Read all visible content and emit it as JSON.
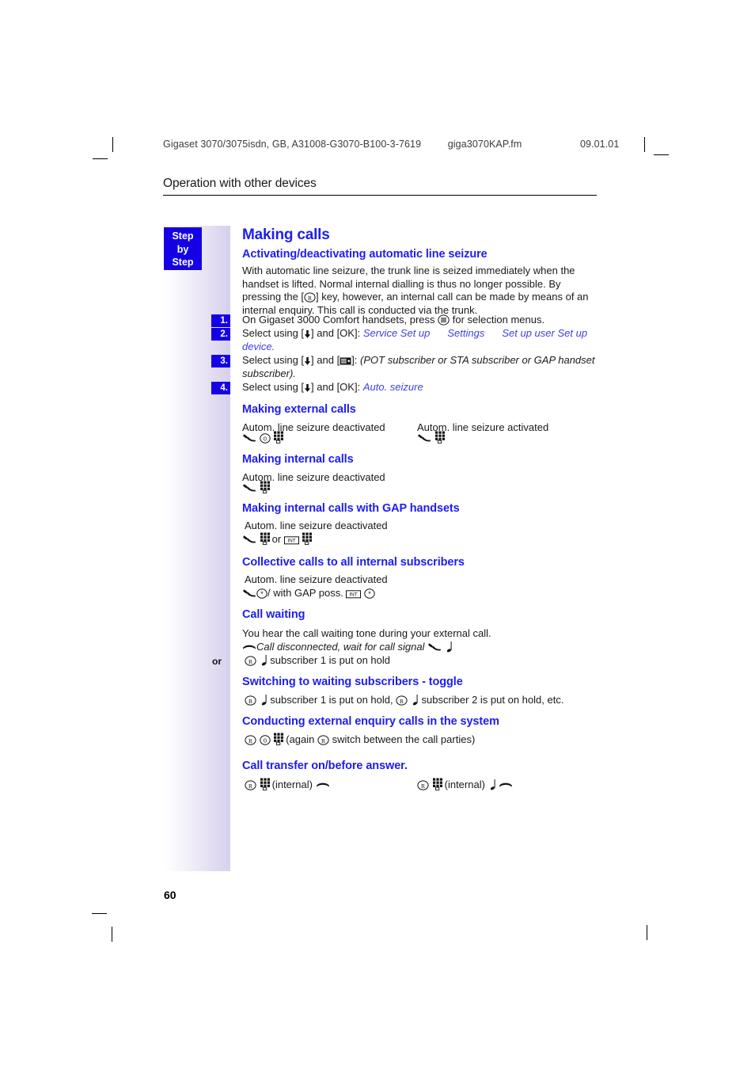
{
  "header": {
    "doc_id": "Gigaset 3070/3075isdn, GB, A31008-G3070-B100-3-7619",
    "file": "giga3070KAP.fm",
    "date": "09.01.01"
  },
  "chapter": {
    "title": "Operation with other devices"
  },
  "sidebar": {
    "badge_line1": "Step",
    "badge_line2": "by",
    "badge_line3": "Step",
    "or_label": "or"
  },
  "main": {
    "h1": "Making calls",
    "section_auto": {
      "heading": "Activating/deactivating automatic line seizure",
      "intro_a": "With automatic line seizure, the trunk line is seized immediately when the handset is lifted. Normal internal dialling is thus no longer possible. By pressing the [",
      "intro_b": "] key, however, an internal call can be made by means of an internal enquiry. This call is conducted via the trunk.",
      "steps": [
        {
          "num": "1.",
          "text_a": "On Gigaset 3000 Comfort handsets, press",
          "text_b": "for selection menus."
        },
        {
          "num": "2.",
          "text_a": "Select using [",
          "text_b": "] and [OK]:",
          "menu1": "Service Set up",
          "menu2": "Settings",
          "menu3": "Set up user",
          "menu4": "Set up device",
          "tail": "."
        },
        {
          "num": "3.",
          "text_a": "Select using [",
          "text_b": "] and [",
          "text_c": "]:",
          "italic": "(POT subscriber or STA subscriber or GAP handset subscriber)."
        },
        {
          "num": "4.",
          "text_a": "Select using [",
          "text_b": "] and [OK]:",
          "menu1": "Auto. seizure"
        }
      ]
    },
    "section_external": {
      "heading": "Making external calls",
      "col1_label": "Autom. line seizure deactivated",
      "col2_label": "Autom. line seizure activated"
    },
    "section_internal": {
      "heading": "Making internal calls",
      "label": "Autom. line seizure deactivated"
    },
    "section_gap": {
      "heading": "Making internal calls with GAP handsets",
      "label": "Autom. line seizure deactivated",
      "or_text": "or"
    },
    "section_collective": {
      "heading": "Collective calls to all internal subscribers",
      "label": "Autom. line seizure deactivated",
      "mid_text": "/ with GAP poss."
    },
    "section_waiting": {
      "heading": "Call waiting",
      "intro": "You hear the call waiting tone during your external call.",
      "line1_italic": "Call disconnected, wait for call signal",
      "line2_text": "subscriber 1 is put on hold"
    },
    "section_toggle": {
      "heading": "Switching to waiting subscribers - toggle",
      "text_a": "subscriber 1 is put on hold,",
      "text_b": "subscriber 2 is put on hold, etc."
    },
    "section_enquiry": {
      "heading": "Conducting external enquiry calls in the system",
      "text_a": "(again",
      "text_b": "switch between the call parties)"
    },
    "section_transfer": {
      "heading": "Call transfer on/before answer.",
      "col1_text": "(internal)",
      "col2_text": "(internal)"
    }
  },
  "footer": {
    "page_number": "60"
  },
  "icons": {
    "r_key": "r-key-icon",
    "menu_key": "menu-key-icon",
    "down_arrow": "down-arrow-key-icon",
    "display_key": "display-key-icon",
    "lift_handset": "lift-handset-icon",
    "hang_up": "hang-up-handset-icon",
    "keypad": "keypad-dial-icon",
    "zero_key": "zero-key-icon",
    "star_key": "star-key-icon",
    "int_key": "int-key-icon",
    "ring": "ring-tone-icon"
  },
  "colors": {
    "heading_blue": "#1d1df0",
    "badge_blue": "#1500e6",
    "sidebar_purple": "#d6d0ec",
    "body_text": "#1a1a1a"
  }
}
